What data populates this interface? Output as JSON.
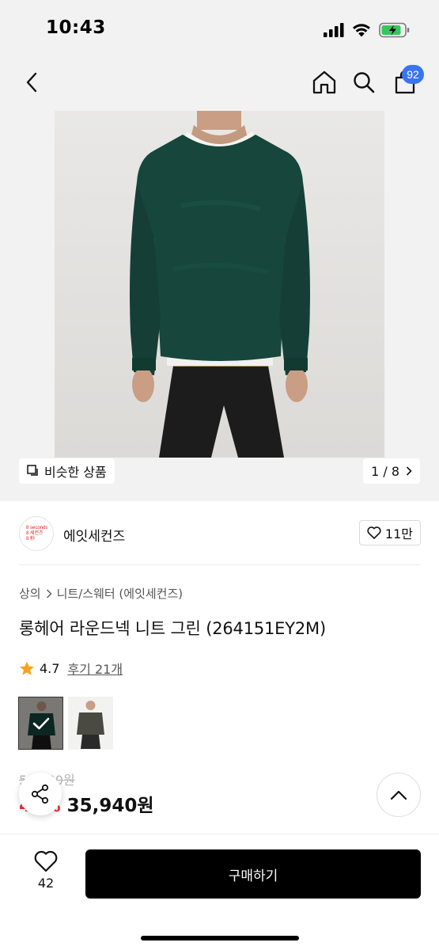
{
  "status_bar": {
    "time": "10:43"
  },
  "nav": {
    "cart_count": "92"
  },
  "gallery": {
    "similar_label": "비슷한 상품",
    "pager": "1 / 8"
  },
  "brand": {
    "logo_lines": [
      "8 seconds",
      "8 세컨즈",
      "8 秒"
    ],
    "name": "에잇세컨즈",
    "like_count": "11만"
  },
  "product": {
    "breadcrumb": [
      "상의",
      "니트/스웨터 (에잇세컨즈)"
    ],
    "title": "롱헤어 라운드넥 니트 그린 (264151EY2M)",
    "rating": "4.7",
    "reviews_label": "후기 21개",
    "original_price": "59,900원",
    "discount_rate": "40%",
    "sale_price": "35,940원"
  },
  "swatches": [
    {
      "color_name": "green",
      "color": "#16463c",
      "selected": true
    },
    {
      "color_name": "charcoal",
      "color": "#4a4a42",
      "selected": false
    }
  ],
  "bottom_bar": {
    "wish_count": "42",
    "buy_label": "구매하기"
  },
  "colors": {
    "accent": "#3b74f0",
    "sale": "#f03030",
    "star": "#f7a21b"
  }
}
